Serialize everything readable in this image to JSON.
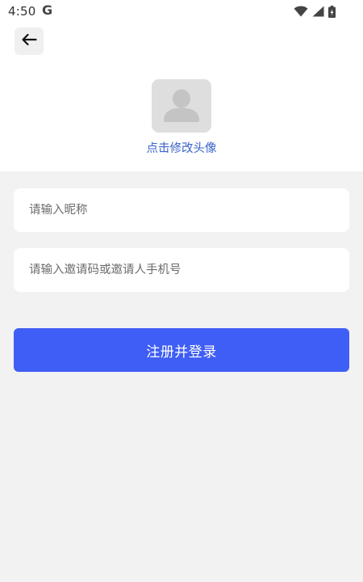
{
  "status_bar": {
    "time": "4:50",
    "carrier_glyph": "G",
    "icons": [
      "wifi-icon",
      "signal-icon",
      "battery-icon"
    ]
  },
  "header": {
    "back_icon": "arrow-left-icon"
  },
  "avatar": {
    "icon": "user-silhouette-icon",
    "label": "点击修改头像"
  },
  "form": {
    "nickname_placeholder": "请输入昵称",
    "nickname_value": "",
    "invite_placeholder": "请输入邀请码或邀请人手机号",
    "invite_value": "",
    "submit_label": "注册并登录"
  },
  "colors": {
    "accent": "#3f5ef5",
    "link": "#3a63c9",
    "background": "#f2f2f2",
    "surface": "#ffffff"
  }
}
